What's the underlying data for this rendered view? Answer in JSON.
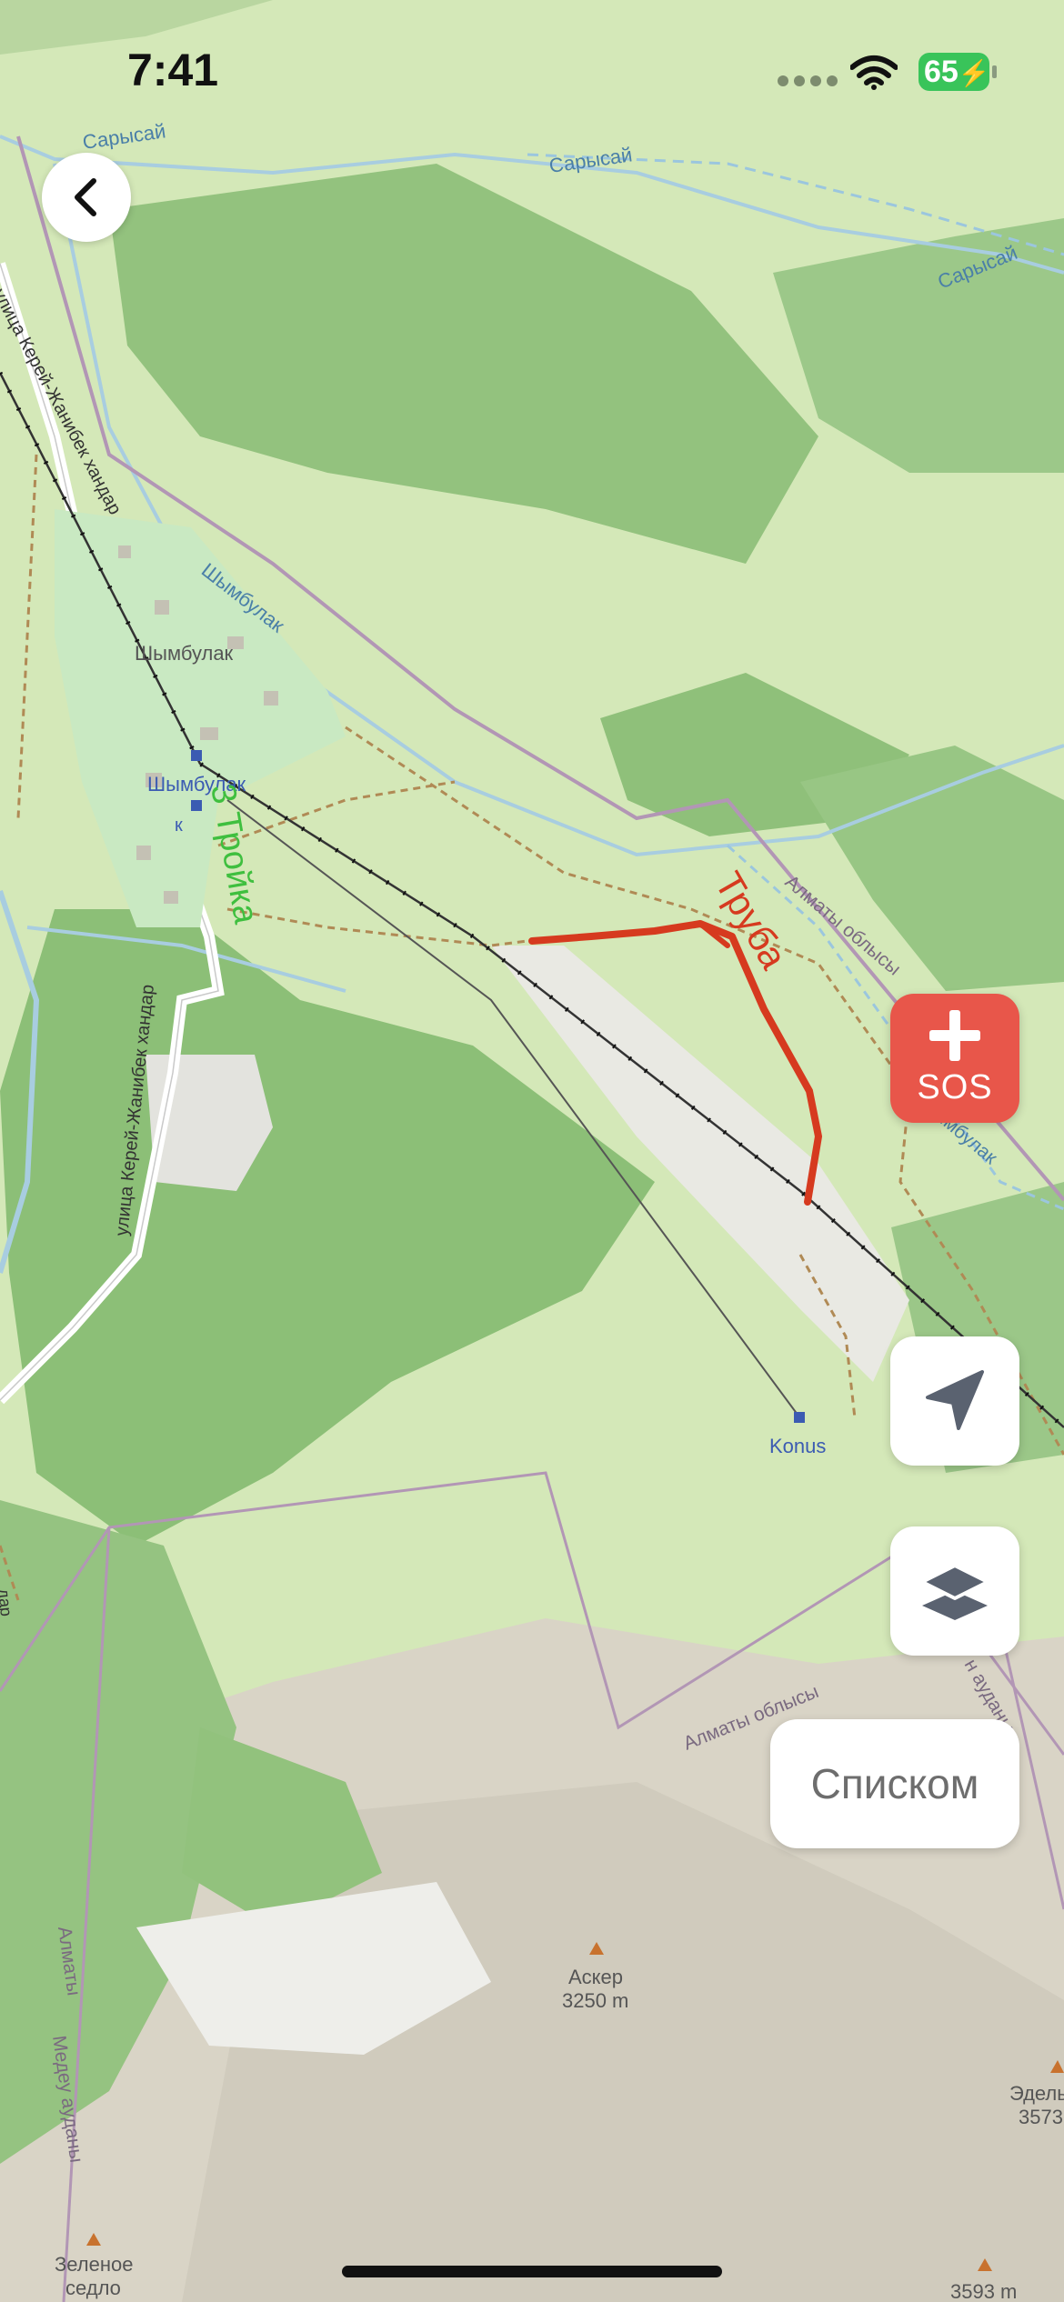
{
  "status_bar": {
    "time": "7:41",
    "battery": "65"
  },
  "map": {
    "labels": {
      "river_top_left": "Сарысай",
      "river_top_center": "Сарысай",
      "river_right": "Сарысай",
      "street_top": "улица Керей-Жанибек хандар",
      "river_shymbulak": "Шымбулак",
      "village": "Шымбулак",
      "lift_station": "Шымбулак",
      "street_bottom": "улица Керей-Жанибек хандар",
      "region_right": "Алматы облысы",
      "river_right_lower": "Шымбулак",
      "konus": "Konus",
      "region_bottom": "Алматы облысы",
      "district_right": "н ауданы",
      "district_left_a": "Алматы",
      "district_left_b": "Медеу ауданы",
      "asker_name": "Аскер",
      "asker_elev": "3250 m",
      "edelweiss_name": "Эдель",
      "edelweiss_elev": "3573",
      "zelenoe_a": "Зеленое",
      "zelenoe_b": "седло",
      "peak_elev": "3593 m",
      "small_left": "к",
      "left_edge": "дар"
    },
    "routes": {
      "highlighted_red": "Труба",
      "highlighted_green": "3 Тройка"
    }
  },
  "controls": {
    "back_icon": "chevron-left-icon",
    "sos_label": "SOS",
    "sos_icon": "plus-icon",
    "locate_icon": "location-arrow-icon",
    "layers_icon": "layers-icon",
    "list_label": "Списком"
  },
  "colors": {
    "sos": "#e8564a",
    "route_red": "#d63a1f",
    "route_green": "#3fbf3f",
    "forest": "#8fc07a",
    "meadow": "#d2e7b4"
  }
}
